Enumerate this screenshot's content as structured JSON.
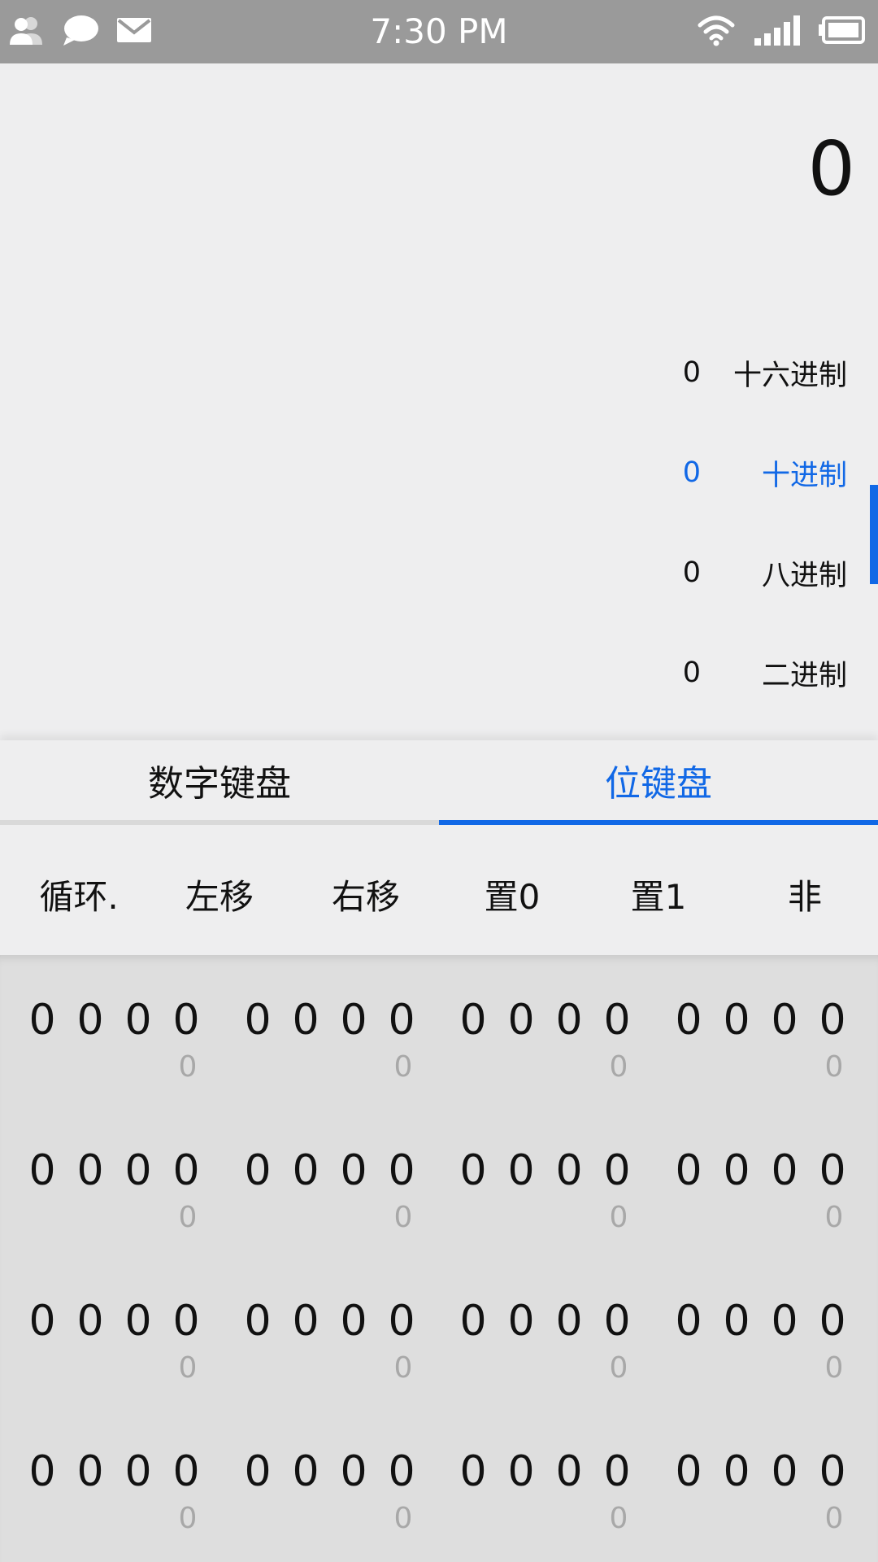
{
  "status_bar": {
    "time": "7:30 PM",
    "left_icons": [
      "contacts-icon",
      "chat-bubble-icon",
      "mail-icon"
    ],
    "right_icons": [
      "wifi-icon",
      "signal-icon",
      "battery-icon"
    ]
  },
  "display": {
    "main_value": "0",
    "bases": [
      {
        "value": "0",
        "name": "十六进制",
        "active": false
      },
      {
        "value": "0",
        "name": "十进制",
        "active": true
      },
      {
        "value": "0",
        "name": "八进制",
        "active": false
      },
      {
        "value": "0",
        "name": "二进制",
        "active": false
      }
    ]
  },
  "tabs": [
    {
      "label": "数字键盘",
      "active": false
    },
    {
      "label": "位键盘",
      "active": true
    }
  ],
  "operations": [
    "循环.",
    "左移",
    "右移",
    "置0",
    "置1",
    "非"
  ],
  "bit_rows": [
    {
      "bits": [
        "0",
        "0",
        "0",
        "0",
        "0",
        "0",
        "0",
        "0",
        "0",
        "0",
        "0",
        "0",
        "0",
        "0",
        "0",
        "0"
      ],
      "indices": [
        "0",
        "0",
        "0",
        "0"
      ]
    },
    {
      "bits": [
        "0",
        "0",
        "0",
        "0",
        "0",
        "0",
        "0",
        "0",
        "0",
        "0",
        "0",
        "0",
        "0",
        "0",
        "0",
        "0"
      ],
      "indices": [
        "0",
        "0",
        "0",
        "0"
      ]
    },
    {
      "bits": [
        "0",
        "0",
        "0",
        "0",
        "0",
        "0",
        "0",
        "0",
        "0",
        "0",
        "0",
        "0",
        "0",
        "0",
        "0",
        "0"
      ],
      "indices": [
        "0",
        "0",
        "0",
        "0"
      ]
    },
    {
      "bits": [
        "0",
        "0",
        "0",
        "0",
        "0",
        "0",
        "0",
        "0",
        "0",
        "0",
        "0",
        "0",
        "0",
        "0",
        "0",
        "0"
      ],
      "indices": [
        "0",
        "0",
        "0",
        "0"
      ]
    }
  ],
  "colors": {
    "accent": "#1168e6",
    "status_bar": "#9a9a9a",
    "background": "#eeeeef",
    "bits_background": "#dedede",
    "index_text": "#a8a8a8"
  }
}
